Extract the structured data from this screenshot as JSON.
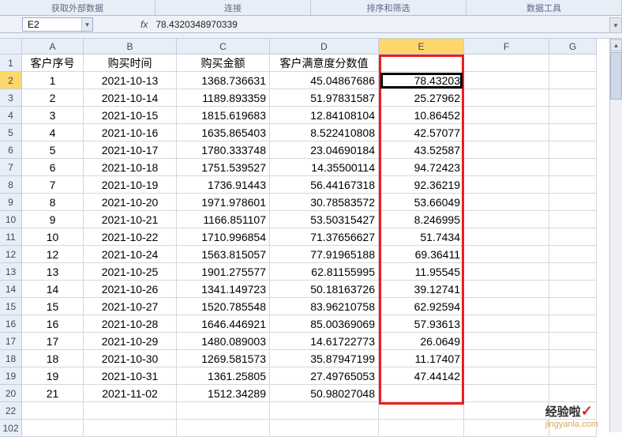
{
  "ribbon": {
    "groups": [
      "获取外部数据",
      "连接",
      "排序和筛选",
      "数据工具"
    ]
  },
  "namebox": {
    "ref": "E2"
  },
  "formula": {
    "fx": "fx",
    "value": "78.4320348970339"
  },
  "columns": [
    "A",
    "B",
    "C",
    "D",
    "E",
    "F",
    "G"
  ],
  "selectedCol": "E",
  "selectedRow": "2",
  "rowNumbers": [
    "1",
    "2",
    "3",
    "4",
    "5",
    "6",
    "7",
    "8",
    "9",
    "10",
    "11",
    "12",
    "13",
    "14",
    "15",
    "16",
    "17",
    "18",
    "19",
    "20",
    "22",
    "102"
  ],
  "headers": {
    "A": "客户序号",
    "B": "购买时间",
    "C": "购买金额",
    "D": "客户满意度分数值",
    "E": "",
    "F": ""
  },
  "rows": [
    {
      "A": "1",
      "B": "2021-10-13",
      "C": "1368.736631",
      "D": "45.04867686",
      "E": "78.43203"
    },
    {
      "A": "2",
      "B": "2021-10-14",
      "C": "1189.893359",
      "D": "51.97831587",
      "E": "25.27962"
    },
    {
      "A": "3",
      "B": "2021-10-15",
      "C": "1815.619683",
      "D": "12.84108104",
      "E": "10.86452"
    },
    {
      "A": "4",
      "B": "2021-10-16",
      "C": "1635.865403",
      "D": "8.522410808",
      "E": "42.57077"
    },
    {
      "A": "5",
      "B": "2021-10-17",
      "C": "1780.333748",
      "D": "23.04690184",
      "E": "43.52587"
    },
    {
      "A": "6",
      "B": "2021-10-18",
      "C": "1751.539527",
      "D": "14.35500114",
      "E": "94.72423"
    },
    {
      "A": "7",
      "B": "2021-10-19",
      "C": "1736.91443",
      "D": "56.44167318",
      "E": "92.36219"
    },
    {
      "A": "8",
      "B": "2021-10-20",
      "C": "1971.978601",
      "D": "30.78583572",
      "E": "53.66049"
    },
    {
      "A": "9",
      "B": "2021-10-21",
      "C": "1166.851107",
      "D": "53.50315427",
      "E": "8.246995"
    },
    {
      "A": "10",
      "B": "2021-10-22",
      "C": "1710.996854",
      "D": "71.37656627",
      "E": "51.7434"
    },
    {
      "A": "12",
      "B": "2021-10-24",
      "C": "1563.815057",
      "D": "77.91965188",
      "E": "69.36411"
    },
    {
      "A": "13",
      "B": "2021-10-25",
      "C": "1901.275577",
      "D": "62.81155995",
      "E": "11.95545"
    },
    {
      "A": "14",
      "B": "2021-10-26",
      "C": "1341.149723",
      "D": "50.18163726",
      "E": "39.12741"
    },
    {
      "A": "15",
      "B": "2021-10-27",
      "C": "1520.785548",
      "D": "83.96210758",
      "E": "62.92594"
    },
    {
      "A": "16",
      "B": "2021-10-28",
      "C": "1646.446921",
      "D": "85.00369069",
      "E": "57.93613"
    },
    {
      "A": "17",
      "B": "2021-10-29",
      "C": "1480.089003",
      "D": "14.61722773",
      "E": "26.0649"
    },
    {
      "A": "18",
      "B": "2021-10-30",
      "C": "1269.581573",
      "D": "35.87947199",
      "E": "11.17407"
    },
    {
      "A": "19",
      "B": "2021-10-31",
      "C": "1361.25805",
      "D": "27.49765053",
      "E": "47.44142"
    },
    {
      "A": "21",
      "B": "2021-11-02",
      "C": "1512.34289",
      "D": "50.98027048",
      "E": ""
    }
  ],
  "watermark": {
    "top": "经验啦",
    "sub": "jingyanla.com"
  }
}
